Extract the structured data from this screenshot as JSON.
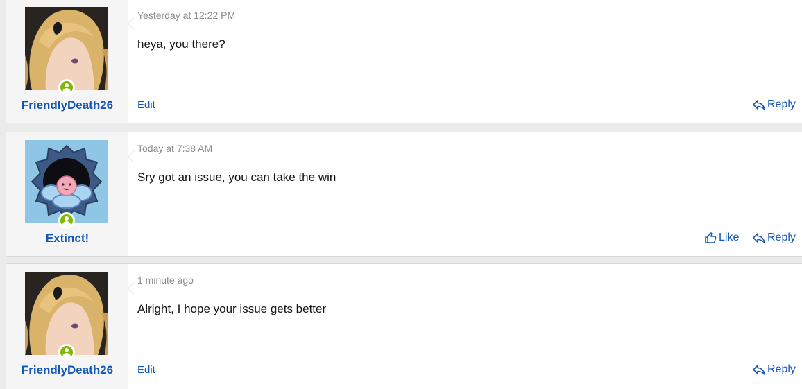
{
  "messages": [
    {
      "username": "FriendlyDeath26",
      "online": true,
      "avatar": "anime-girl-blonde-avatar",
      "timestamp": "Yesterday at 12:22 PM",
      "body": "heya, you there?",
      "edit_label": "Edit",
      "like_label": null,
      "reply_label": "Reply"
    },
    {
      "username": "Extinct!",
      "online": true,
      "avatar": "gear-creature-avatar",
      "timestamp": "Today at 7:38 AM",
      "body": "Sry got an issue, you can take the win",
      "edit_label": null,
      "like_label": "Like",
      "reply_label": "Reply"
    },
    {
      "username": "FriendlyDeath26",
      "online": true,
      "avatar": "anime-girl-blonde-avatar",
      "timestamp": "1 minute ago",
      "body": "Alright, I hope your issue gets better",
      "edit_label": "Edit",
      "like_label": null,
      "reply_label": "Reply"
    }
  ],
  "colors": {
    "link": "#1356b8",
    "online": "#7fb900",
    "timestamp": "#8c8c8c",
    "user_cell_bg": "#f5f5f5",
    "page_bg": "#ebebeb"
  }
}
